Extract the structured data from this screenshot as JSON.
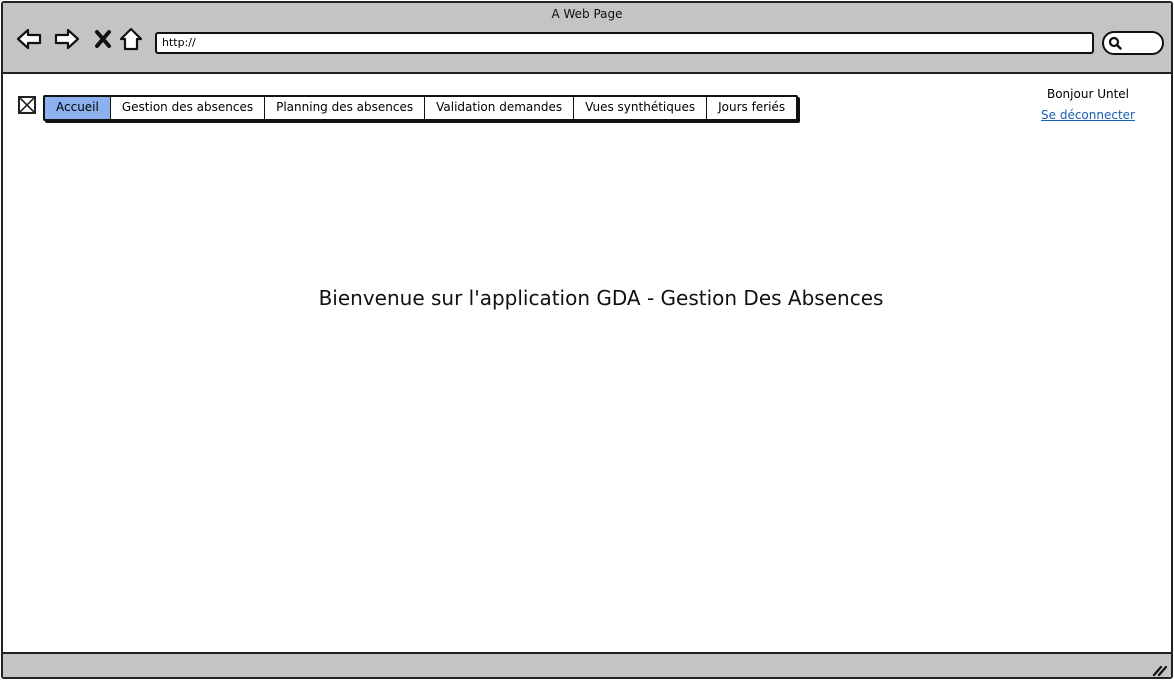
{
  "browser": {
    "title": "A Web Page",
    "url": "http://",
    "icons": {
      "back": "back-arrow-icon",
      "forward": "forward-arrow-icon",
      "stop": "close-icon",
      "home": "home-icon",
      "search": "search-icon"
    }
  },
  "menu": {
    "items": [
      {
        "label": "Accueil",
        "active": true
      },
      {
        "label": "Gestion des absences",
        "active": false
      },
      {
        "label": "Planning des absences",
        "active": false
      },
      {
        "label": "Validation demandes",
        "active": false
      },
      {
        "label": "Vues synthétiques",
        "active": false
      },
      {
        "label": "Jours feriés",
        "active": false
      }
    ],
    "active_color": "#8cb1ee"
  },
  "user": {
    "greeting": "Bonjour Untel",
    "logout_label": "Se déconnecter"
  },
  "main": {
    "welcome": "Bienvenue sur l'application GDA - Gestion Des Absences"
  }
}
